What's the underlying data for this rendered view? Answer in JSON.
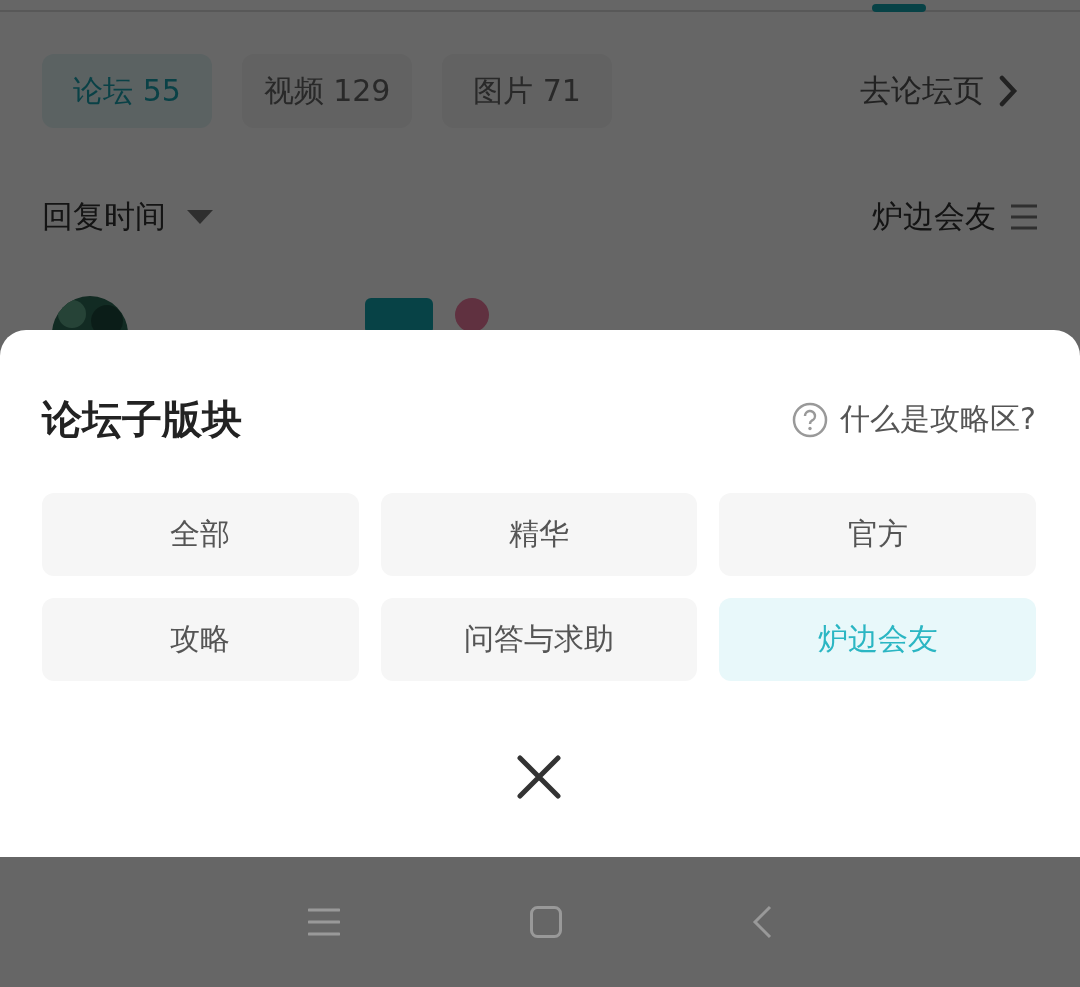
{
  "content_tabs": [
    {
      "label": "论坛",
      "count": "55",
      "selected": true
    },
    {
      "label": "视频",
      "count": "129",
      "selected": false
    },
    {
      "label": "图片",
      "count": "71",
      "selected": false
    }
  ],
  "forum_link": "去论坛页",
  "sort": {
    "label": "回复时间"
  },
  "filter": {
    "label": "炉边会友"
  },
  "sheet": {
    "title": "论坛子版块",
    "help": "什么是攻略区?",
    "sections": [
      {
        "label": "全部",
        "selected": false
      },
      {
        "label": "精华",
        "selected": false
      },
      {
        "label": "官方",
        "selected": false
      },
      {
        "label": "攻略",
        "selected": false
      },
      {
        "label": "问答与求助",
        "selected": false
      },
      {
        "label": "炉边会友",
        "selected": true
      }
    ]
  }
}
